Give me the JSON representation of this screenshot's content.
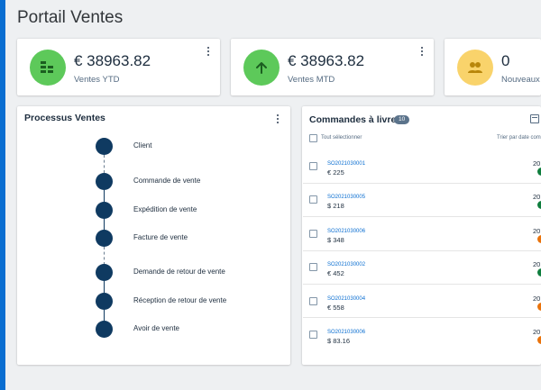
{
  "page": {
    "title": "Portail Ventes"
  },
  "colors": {
    "accent": "#0a6ed1",
    "green": "#5dc95a",
    "yellow": "#f9d36b",
    "step": "#0f3a61",
    "status_green": "#107e3e",
    "status_orange": "#e9730c"
  },
  "kpis": [
    {
      "value": "€ 38963.82",
      "label": "Ventes YTD",
      "icon": "stacked-coins-icon"
    },
    {
      "value": "€ 38963.82",
      "label": "Ventes MTD",
      "icon": "arrow-up-icon"
    },
    {
      "value": "0",
      "label": "Nouveaux c",
      "icon": "people-icon"
    }
  ],
  "process": {
    "title": "Processus Ventes",
    "steps": [
      {
        "label": "Client"
      },
      {
        "label": "Commande de vente"
      },
      {
        "label": "Expédition de vente"
      },
      {
        "label": "Facture de vente"
      },
      {
        "label": "Demande de retour de vente"
      },
      {
        "label": "Réception de retour de vente"
      },
      {
        "label": "Avoir de vente"
      }
    ]
  },
  "orders": {
    "title": "Commandes à livrer",
    "count": "10",
    "select_all": "Tout sélectionner",
    "sort_label": "Trier par date com",
    "rows": [
      {
        "id": "SO2021030001",
        "amount": "€ 225",
        "year": "20",
        "status": "green"
      },
      {
        "id": "SO2021030005",
        "amount": "$ 218",
        "year": "20",
        "status": "green"
      },
      {
        "id": "SO2021030006",
        "amount": "$ 348",
        "year": "20",
        "status": "orange"
      },
      {
        "id": "SO2021030002",
        "amount": "€ 452",
        "year": "20",
        "status": "green"
      },
      {
        "id": "SO2021030004",
        "amount": "€ 558",
        "year": "20",
        "status": "orange"
      },
      {
        "id": "SO2021030006",
        "amount": "$ 83.16",
        "year": "20",
        "status": "orange"
      }
    ]
  }
}
